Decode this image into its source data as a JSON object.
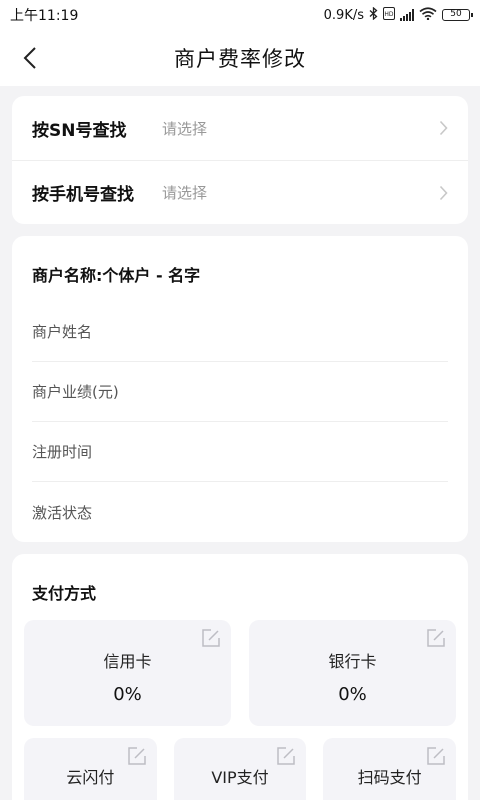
{
  "status_bar": {
    "time": "上午11:19",
    "speed": "0.9K/s",
    "battery": "50"
  },
  "nav": {
    "title": "商户费率修改"
  },
  "search": {
    "rows": [
      {
        "label": "按SN号查找",
        "value": "请选择"
      },
      {
        "label": "按手机号查找",
        "value": "请选择"
      }
    ]
  },
  "merchant": {
    "title": "商户名称:个体户 - 名字",
    "fields": [
      "商户姓名",
      "商户业绩(元)",
      "注册时间",
      "激活状态"
    ]
  },
  "payment": {
    "title": "支付方式",
    "large": [
      {
        "name": "信用卡",
        "rate": "0%"
      },
      {
        "name": "银行卡",
        "rate": "0%"
      }
    ],
    "small": [
      {
        "name": "云闪付"
      },
      {
        "name": "VIP支付"
      },
      {
        "name": "扫码支付"
      }
    ]
  },
  "icons": {
    "back": "back-arrow-icon",
    "chevron": "chevron-right-icon",
    "edit": "edit-icon"
  }
}
